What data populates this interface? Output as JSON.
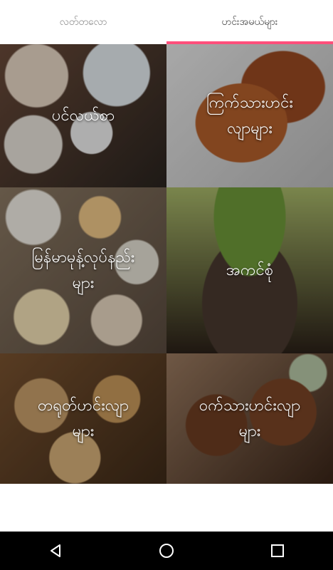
{
  "tabs": [
    {
      "label": "လတ်တလော"
    },
    {
      "label": "ဟင်းအမယ်များ"
    }
  ],
  "categories": [
    {
      "label_line1": "ပင်လယ်စာ",
      "label_line2": ""
    },
    {
      "label_line1": "ကြက်သားဟင်း",
      "label_line2": "လျာများ"
    },
    {
      "label_line1": "မြန်မာမုန့်လုပ်နည်း",
      "label_line2": "များ"
    },
    {
      "label_line1": "အကင်စုံ",
      "label_line2": ""
    },
    {
      "label_line1": "တရုတ်ဟင်းလျာ",
      "label_line2": "များ"
    },
    {
      "label_line1": "ဝက်သားဟင်းလျာ",
      "label_line2": "များ"
    }
  ],
  "navbar": {
    "icons": [
      "back-icon",
      "home-icon",
      "recents-icon"
    ]
  }
}
